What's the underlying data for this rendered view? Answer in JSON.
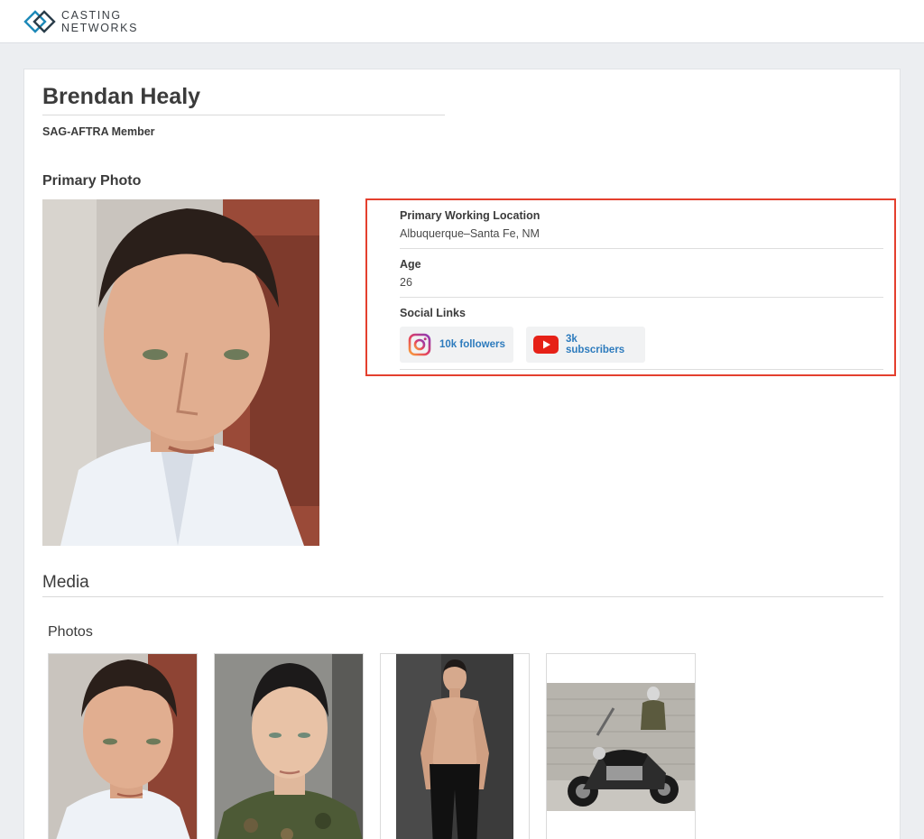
{
  "brand": {
    "line1": "CASTING",
    "line2": "NETWORKS"
  },
  "profile": {
    "name": "Brendan Healy",
    "union": "SAG-AFTRA Member"
  },
  "primary_photo": {
    "heading": "Primary Photo"
  },
  "details": {
    "location_label": "Primary Working Location",
    "location_value": "Albuquerque–Santa Fe, NM",
    "age_label": "Age",
    "age_value": "26",
    "social_label": "Social Links",
    "instagram": "10k followers",
    "youtube": "3k subscribers"
  },
  "media": {
    "heading": "Media",
    "photos_heading": "Photos"
  },
  "colors": {
    "highlight": "#e4402e",
    "link": "#2d7bbd",
    "youtube": "#e62117",
    "brand": "#1d89b8"
  }
}
